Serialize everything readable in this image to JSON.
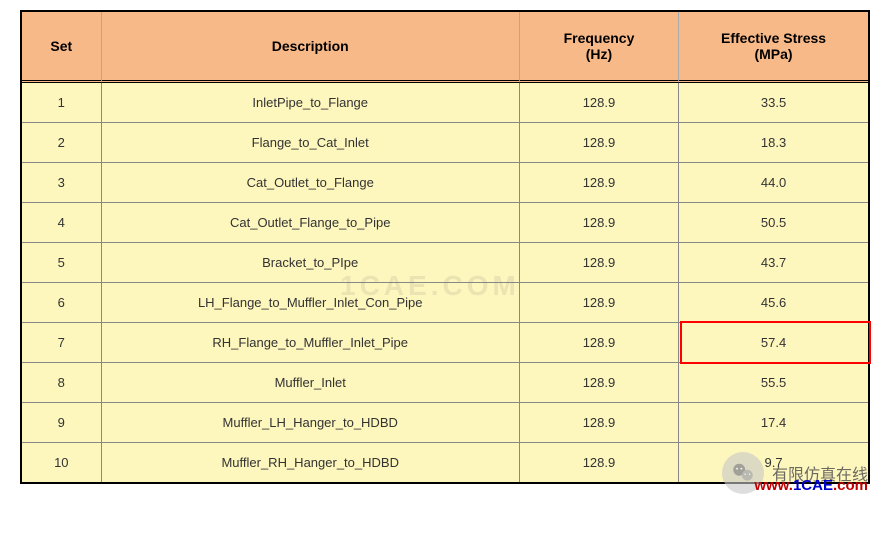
{
  "table": {
    "headers": {
      "set": "Set",
      "description": "Description",
      "frequency": "Frequency\n(Hz)",
      "stress": "Effective Stress\n(MPa)"
    },
    "rows": [
      {
        "set": "1",
        "description": "InletPipe_to_Flange",
        "frequency": "128.9",
        "stress": "33.5",
        "highlight": false
      },
      {
        "set": "2",
        "description": "Flange_to_Cat_Inlet",
        "frequency": "128.9",
        "stress": "18.3",
        "highlight": false
      },
      {
        "set": "3",
        "description": "Cat_Outlet_to_Flange",
        "frequency": "128.9",
        "stress": "44.0",
        "highlight": false
      },
      {
        "set": "4",
        "description": "Cat_Outlet_Flange_to_Pipe",
        "frequency": "128.9",
        "stress": "50.5",
        "highlight": false
      },
      {
        "set": "5",
        "description": "Bracket_to_PIpe",
        "frequency": "128.9",
        "stress": "43.7",
        "highlight": false
      },
      {
        "set": "6",
        "description": "LH_Flange_to_Muffler_Inlet_Con_Pipe",
        "frequency": "128.9",
        "stress": "45.6",
        "highlight": false
      },
      {
        "set": "7",
        "description": "RH_Flange_to_Muffler_Inlet_Pipe",
        "frequency": "128.9",
        "stress": "57.4",
        "highlight": true
      },
      {
        "set": "8",
        "description": "Muffler_Inlet",
        "frequency": "128.9",
        "stress": "55.5",
        "highlight": false
      },
      {
        "set": "9",
        "description": "Muffler_LH_Hanger_to_HDBD",
        "frequency": "128.9",
        "stress": "17.4",
        "highlight": false
      },
      {
        "set": "10",
        "description": "Muffler_RH_Hanger_to_HDBD",
        "frequency": "128.9",
        "stress": "9.7",
        "highlight": false
      }
    ]
  },
  "watermark_center": "1CAE.COM",
  "footer": {
    "cn_text": "有限仿真在线",
    "url_prefix": "www.",
    "url_main": "1CAE",
    "url_suffix": ".com"
  }
}
